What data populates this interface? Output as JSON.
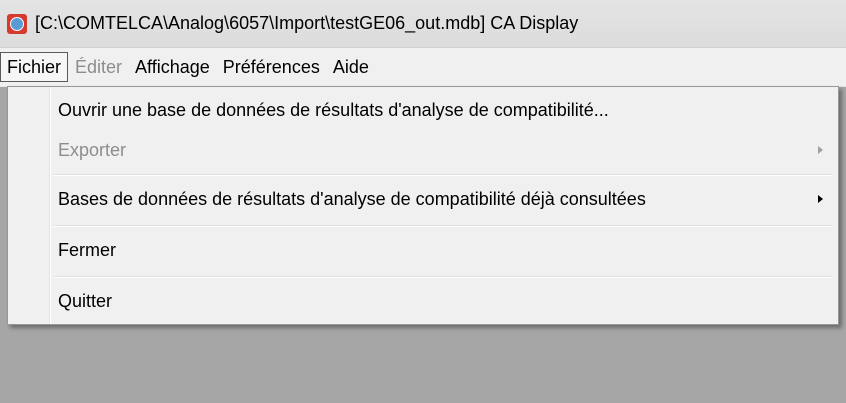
{
  "window": {
    "title": "[C:\\COMTELCA\\Analog\\6057\\Import\\testGE06_out.mdb] CA Display",
    "icon": "itu-globe-icon"
  },
  "menubar": {
    "items": [
      {
        "label": "Fichier",
        "state": "open"
      },
      {
        "label": "Éditer",
        "state": "disabled"
      },
      {
        "label": "Affichage",
        "state": "normal"
      },
      {
        "label": "Préférences",
        "state": "normal"
      },
      {
        "label": "Aide",
        "state": "normal"
      }
    ]
  },
  "file_menu": {
    "items": [
      {
        "label": "Ouvrir une base de données de résultats d'analyse de compatibilité...",
        "enabled": true,
        "submenu": false
      },
      {
        "label": "Exporter",
        "enabled": false,
        "submenu": true
      },
      {
        "label": "Bases de données de résultats d'analyse de compatibilité déjà consultées",
        "enabled": true,
        "submenu": true
      },
      {
        "label": "Fermer",
        "enabled": true,
        "submenu": false
      },
      {
        "label": "Quitter",
        "enabled": true,
        "submenu": false
      }
    ]
  },
  "colors": {
    "menu_background": "#f0f0f0",
    "disabled_text": "#8d8d8d",
    "workspace": "#a6a6a6"
  }
}
